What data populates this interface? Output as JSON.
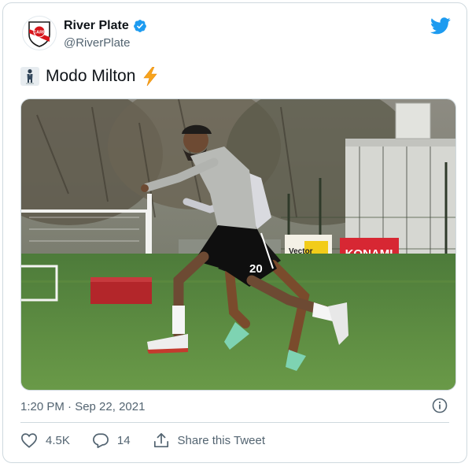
{
  "user": {
    "name": "River Plate",
    "handle": "@RiverPlate",
    "avatar_letters": "CARP",
    "verified": true
  },
  "tweet": {
    "text": "Modo Milton",
    "leading_emoji": "man-in-suit-levitating",
    "trailing_emoji": "high-voltage"
  },
  "media": {
    "description_icon": "training-photo",
    "sign_konami": "KONAMI",
    "sign_sponsor": "Vector",
    "jersey_number": "20"
  },
  "timestamp": "1:20 PM · Sep 22, 2021",
  "actions": {
    "likes": "4.5K",
    "replies": "14",
    "share_label": "Share this Tweet"
  },
  "colors": {
    "twitter_blue": "#1d9bf0",
    "verified_blue": "#1d9bf0",
    "secondary_text": "#536471",
    "border": "#cfd9de",
    "river_red": "#d7141a"
  }
}
